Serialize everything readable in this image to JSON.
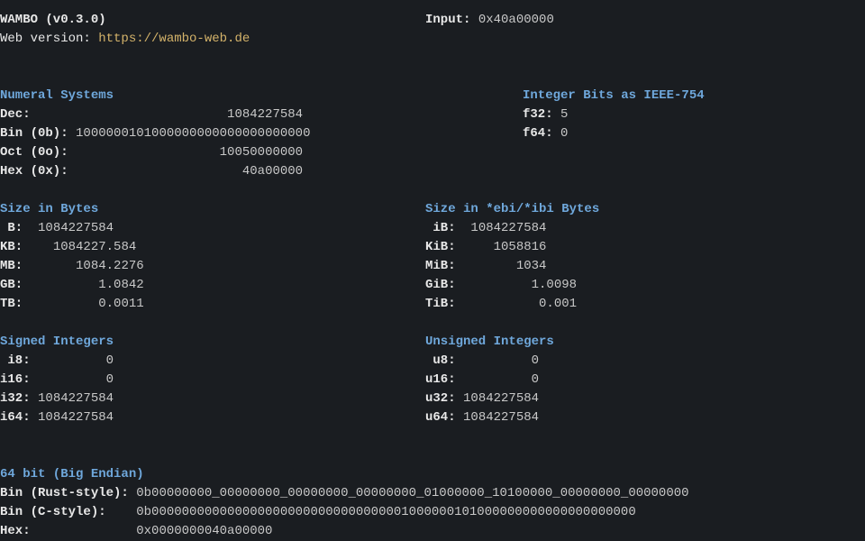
{
  "header": {
    "title": "WAMBO (v0.3.0)",
    "web_label": "Web version: ",
    "web_url": "https://wambo-web.de",
    "input_label": "Input:",
    "input_value": "0x40a00000"
  },
  "numeral": {
    "heading": "Numeral Systems",
    "dec_label": "Dec:",
    "dec_value": "1084227584",
    "bin_label": "Bin (0b):",
    "bin_value": "1000000101000000000000000000000",
    "oct_label": "Oct (0o):",
    "oct_value": "10050000000",
    "hex_label": "Hex (0x):",
    "hex_value": "40a00000"
  },
  "ieee": {
    "heading": "Integer Bits as IEEE-754",
    "f32_label": "f32:",
    "f32_value": "5",
    "f64_label": "f64:",
    "f64_value": "0"
  },
  "bytes": {
    "heading": "Size in Bytes",
    "b_label": " B:",
    "b_value": "1084227584",
    "kb_label": "KB:",
    "kb_value": "1084227.584",
    "mb_label": "MB:",
    "mb_value": "1084.2276",
    "gb_label": "GB:",
    "gb_value": "1.0842",
    "tb_label": "TB:",
    "tb_value": "0.0011"
  },
  "ibytes": {
    "heading": "Size in *ebi/*ibi Bytes",
    "ib_label": " iB:",
    "ib_value": "1084227584",
    "kib_label": "KiB:",
    "kib_value": "1058816",
    "mib_label": "MiB:",
    "mib_value": "1034",
    "gib_label": "GiB:",
    "gib_value": "1.0098",
    "tib_label": "TiB:",
    "tib_value": "0.001"
  },
  "signed": {
    "heading": "Signed Integers",
    "i8_label": " i8:",
    "i8_value": "0",
    "i16_label": "i16:",
    "i16_value": "0",
    "i32_label": "i32:",
    "i32_value": "1084227584",
    "i64_label": "i64:",
    "i64_value": "1084227584"
  },
  "unsigned": {
    "heading": "Unsigned Integers",
    "u8_label": " u8:",
    "u8_value": "0",
    "u16_label": "u16:",
    "u16_value": "0",
    "u32_label": "u32:",
    "u32_value": "1084227584",
    "u64_label": "u64:",
    "u64_value": "1084227584"
  },
  "big_endian": {
    "heading": "64 bit (Big Endian)",
    "bin_rust_label": "Bin (Rust-style):",
    "bin_rust_value": "0b00000000_00000000_00000000_00000000_01000000_10100000_00000000_00000000",
    "bin_c_label": "Bin (C-style):",
    "bin_c_value": "0b0000000000000000000000000000000001000000101000000000000000000000",
    "hex_label": "Hex:",
    "hex_value": "0x0000000040a00000"
  }
}
